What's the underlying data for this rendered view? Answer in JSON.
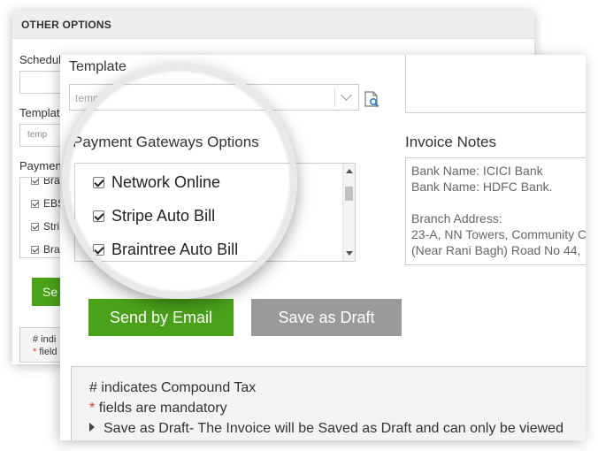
{
  "back_panel": {
    "header": "OTHER OPTIONS",
    "schedule_label": "Schedul",
    "template_label": "Templat",
    "template_value": "temp",
    "payment_label": "Paymen",
    "gateways": [
      {
        "label": "Bra",
        "checked": true
      },
      {
        "label": "EBS",
        "checked": true
      },
      {
        "label": "Stri",
        "checked": true
      },
      {
        "label": "Bra",
        "checked": true
      }
    ],
    "send_button": "Se",
    "note_line1": "# indi",
    "note_line2_star": "*",
    "note_line2": "field"
  },
  "front_panel": {
    "template_label": "Template",
    "template_value": "temp",
    "gateways_label": "Payment Gateways Options",
    "gateways": [
      {
        "label": "Network Online",
        "checked": true
      },
      {
        "label": "Stripe Auto Bill",
        "checked": true
      },
      {
        "label": "Braintree Auto Bill",
        "checked": true
      }
    ],
    "invoice_notes_label": "Invoice Notes",
    "invoice_notes": {
      "line1": "Bank Name: ICICI Bank",
      "line2": "Bank Name: HDFC Bank.",
      "line3": "Branch Address:",
      "line4": "23-A, NN Towers, Community C",
      "line5": "(Near Rani Bagh) Road No 44,"
    },
    "send_email_button": "Send by Email",
    "save_draft_button": "Save as Draft",
    "info": {
      "compound_tax": "# indicates Compound Tax",
      "mandatory_star": "*",
      "mandatory": "fields are mandatory",
      "draft_note": "Save as Draft- The Invoice will be Saved as Draft and can only be viewed"
    }
  },
  "colors": {
    "primary_green": "#4aa21a",
    "secondary_gray": "#9a9a9a",
    "required_red": "#e33333"
  }
}
